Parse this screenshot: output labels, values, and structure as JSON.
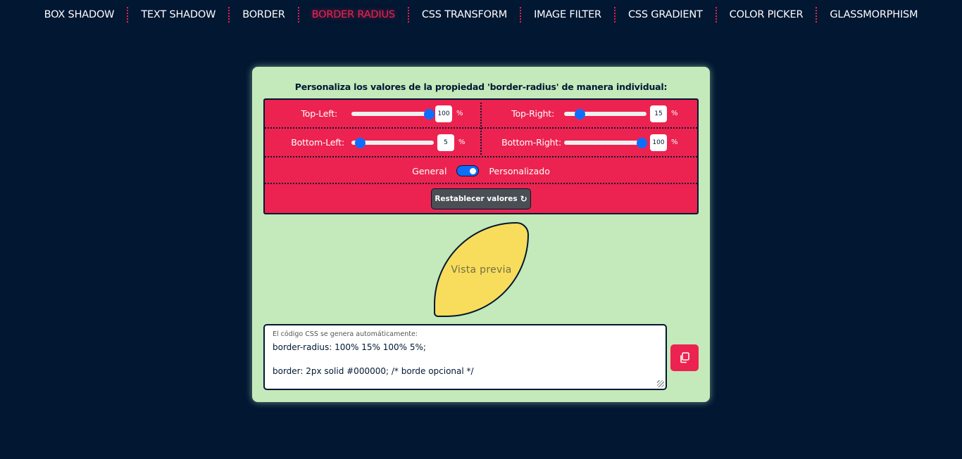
{
  "nav": {
    "items": [
      {
        "label": "BOX SHADOW"
      },
      {
        "label": "TEXT SHADOW"
      },
      {
        "label": "BORDER"
      },
      {
        "label": "BORDER RADIUS"
      },
      {
        "label": "CSS TRANSFORM"
      },
      {
        "label": "IMAGE FILTER"
      },
      {
        "label": "CSS GRADIENT"
      },
      {
        "label": "COLOR PICKER"
      },
      {
        "label": "GLASSMORPHISM"
      }
    ],
    "active_index": 3,
    "separator_color": "#ec2350"
  },
  "card": {
    "title": "Personaliza los valores de la propiedad 'border-radius' de manera individual:",
    "sliders": {
      "top_left": {
        "label": "Top-Left:",
        "value": "100",
        "unit": "%",
        "fraction": 1.0
      },
      "top_right": {
        "label": "Top-Right:",
        "value": "15",
        "unit": "%",
        "fraction": 0.15
      },
      "bottom_left": {
        "label": "Bottom-Left:",
        "value": "5",
        "unit": "%",
        "fraction": 0.05
      },
      "bottom_right": {
        "label": "Bottom-Right:",
        "value": "100",
        "unit": "%",
        "fraction": 1.0
      }
    },
    "toggle": {
      "left_label": "General",
      "right_label": "Personalizado",
      "checked": true
    },
    "reset_label": "Restablecer valores",
    "preview_label": "Vista previa",
    "code": {
      "hint": "El código CSS se genera automáticamente:",
      "line1": "border-radius: 100% 15% 100% 5%;",
      "line2": "border: 2px solid #000000;  /* borde opcional */"
    }
  },
  "colors": {
    "background": "#011732",
    "accent": "#ec2350",
    "card": "#c4e9bb",
    "preview_fill": "#f8dc5c",
    "slider_thumb": "#0d6efd"
  }
}
